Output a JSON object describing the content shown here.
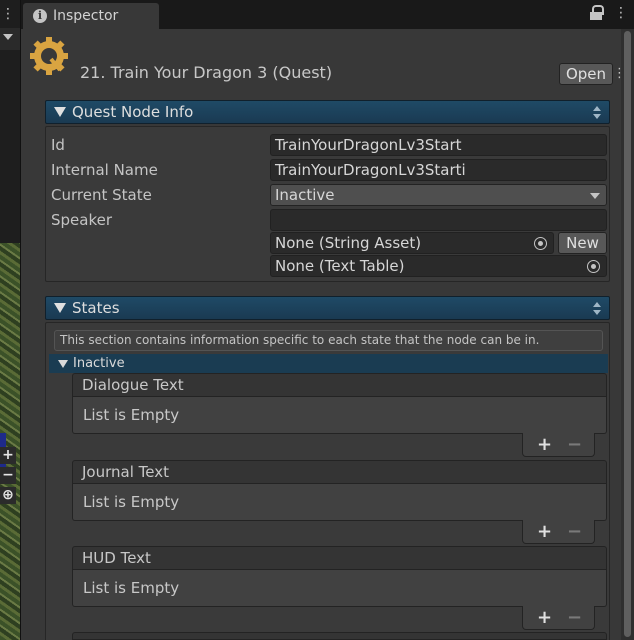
{
  "window": {
    "tab_title": "Inspector"
  },
  "header": {
    "title": "21. Train Your Dragon 3 (Quest)",
    "open_label": "Open"
  },
  "quest_node_info": {
    "section_title": "Quest Node Info",
    "fields": {
      "id": {
        "label": "Id",
        "value": "TrainYourDragonLv3Start"
      },
      "internal_name": {
        "label": "Internal Name",
        "value": "TrainYourDragonLv3Starti"
      },
      "current_state": {
        "label": "Current State",
        "value": "Inactive"
      },
      "speaker": {
        "label": "Speaker",
        "value": "",
        "string_asset": "None (String Asset)",
        "text_table": "None (Text Table)",
        "new_label": "New"
      }
    }
  },
  "states": {
    "section_title": "States",
    "help": "This section contains information specific to each state that the node can be in.",
    "state_name": "Inactive",
    "lists": [
      {
        "title": "Dialogue Text",
        "empty": "List is Empty"
      },
      {
        "title": "Journal Text",
        "empty": "List is Empty"
      },
      {
        "title": "HUD Text",
        "empty": "List is Empty"
      }
    ],
    "add_symbol": "+",
    "remove_symbol": "−"
  },
  "colors": {
    "accent_header": "#1f4a66",
    "panel_bg": "#383838",
    "logo": "#d9a441"
  }
}
